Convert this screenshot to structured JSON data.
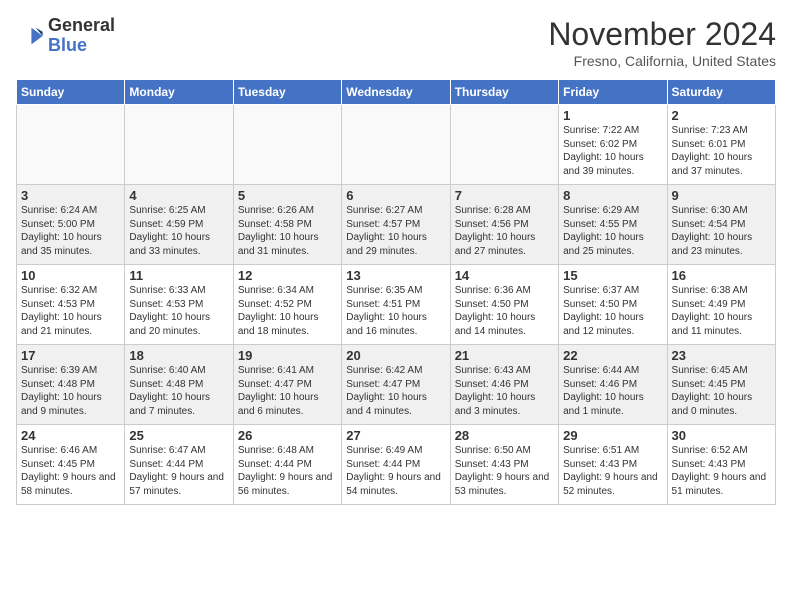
{
  "logo": {
    "line1": "General",
    "line2": "Blue"
  },
  "title": "November 2024",
  "location": "Fresno, California, United States",
  "weekdays": [
    "Sunday",
    "Monday",
    "Tuesday",
    "Wednesday",
    "Thursday",
    "Friday",
    "Saturday"
  ],
  "weeks": [
    [
      {
        "num": "",
        "info": ""
      },
      {
        "num": "",
        "info": ""
      },
      {
        "num": "",
        "info": ""
      },
      {
        "num": "",
        "info": ""
      },
      {
        "num": "",
        "info": ""
      },
      {
        "num": "1",
        "info": "Sunrise: 7:22 AM\nSunset: 6:02 PM\nDaylight: 10 hours and 39 minutes."
      },
      {
        "num": "2",
        "info": "Sunrise: 7:23 AM\nSunset: 6:01 PM\nDaylight: 10 hours and 37 minutes."
      }
    ],
    [
      {
        "num": "3",
        "info": "Sunrise: 6:24 AM\nSunset: 5:00 PM\nDaylight: 10 hours and 35 minutes."
      },
      {
        "num": "4",
        "info": "Sunrise: 6:25 AM\nSunset: 4:59 PM\nDaylight: 10 hours and 33 minutes."
      },
      {
        "num": "5",
        "info": "Sunrise: 6:26 AM\nSunset: 4:58 PM\nDaylight: 10 hours and 31 minutes."
      },
      {
        "num": "6",
        "info": "Sunrise: 6:27 AM\nSunset: 4:57 PM\nDaylight: 10 hours and 29 minutes."
      },
      {
        "num": "7",
        "info": "Sunrise: 6:28 AM\nSunset: 4:56 PM\nDaylight: 10 hours and 27 minutes."
      },
      {
        "num": "8",
        "info": "Sunrise: 6:29 AM\nSunset: 4:55 PM\nDaylight: 10 hours and 25 minutes."
      },
      {
        "num": "9",
        "info": "Sunrise: 6:30 AM\nSunset: 4:54 PM\nDaylight: 10 hours and 23 minutes."
      }
    ],
    [
      {
        "num": "10",
        "info": "Sunrise: 6:32 AM\nSunset: 4:53 PM\nDaylight: 10 hours and 21 minutes."
      },
      {
        "num": "11",
        "info": "Sunrise: 6:33 AM\nSunset: 4:53 PM\nDaylight: 10 hours and 20 minutes."
      },
      {
        "num": "12",
        "info": "Sunrise: 6:34 AM\nSunset: 4:52 PM\nDaylight: 10 hours and 18 minutes."
      },
      {
        "num": "13",
        "info": "Sunrise: 6:35 AM\nSunset: 4:51 PM\nDaylight: 10 hours and 16 minutes."
      },
      {
        "num": "14",
        "info": "Sunrise: 6:36 AM\nSunset: 4:50 PM\nDaylight: 10 hours and 14 minutes."
      },
      {
        "num": "15",
        "info": "Sunrise: 6:37 AM\nSunset: 4:50 PM\nDaylight: 10 hours and 12 minutes."
      },
      {
        "num": "16",
        "info": "Sunrise: 6:38 AM\nSunset: 4:49 PM\nDaylight: 10 hours and 11 minutes."
      }
    ],
    [
      {
        "num": "17",
        "info": "Sunrise: 6:39 AM\nSunset: 4:48 PM\nDaylight: 10 hours and 9 minutes."
      },
      {
        "num": "18",
        "info": "Sunrise: 6:40 AM\nSunset: 4:48 PM\nDaylight: 10 hours and 7 minutes."
      },
      {
        "num": "19",
        "info": "Sunrise: 6:41 AM\nSunset: 4:47 PM\nDaylight: 10 hours and 6 minutes."
      },
      {
        "num": "20",
        "info": "Sunrise: 6:42 AM\nSunset: 4:47 PM\nDaylight: 10 hours and 4 minutes."
      },
      {
        "num": "21",
        "info": "Sunrise: 6:43 AM\nSunset: 4:46 PM\nDaylight: 10 hours and 3 minutes."
      },
      {
        "num": "22",
        "info": "Sunrise: 6:44 AM\nSunset: 4:46 PM\nDaylight: 10 hours and 1 minute."
      },
      {
        "num": "23",
        "info": "Sunrise: 6:45 AM\nSunset: 4:45 PM\nDaylight: 10 hours and 0 minutes."
      }
    ],
    [
      {
        "num": "24",
        "info": "Sunrise: 6:46 AM\nSunset: 4:45 PM\nDaylight: 9 hours and 58 minutes."
      },
      {
        "num": "25",
        "info": "Sunrise: 6:47 AM\nSunset: 4:44 PM\nDaylight: 9 hours and 57 minutes."
      },
      {
        "num": "26",
        "info": "Sunrise: 6:48 AM\nSunset: 4:44 PM\nDaylight: 9 hours and 56 minutes."
      },
      {
        "num": "27",
        "info": "Sunrise: 6:49 AM\nSunset: 4:44 PM\nDaylight: 9 hours and 54 minutes."
      },
      {
        "num": "28",
        "info": "Sunrise: 6:50 AM\nSunset: 4:43 PM\nDaylight: 9 hours and 53 minutes."
      },
      {
        "num": "29",
        "info": "Sunrise: 6:51 AM\nSunset: 4:43 PM\nDaylight: 9 hours and 52 minutes."
      },
      {
        "num": "30",
        "info": "Sunrise: 6:52 AM\nSunset: 4:43 PM\nDaylight: 9 hours and 51 minutes."
      }
    ]
  ]
}
